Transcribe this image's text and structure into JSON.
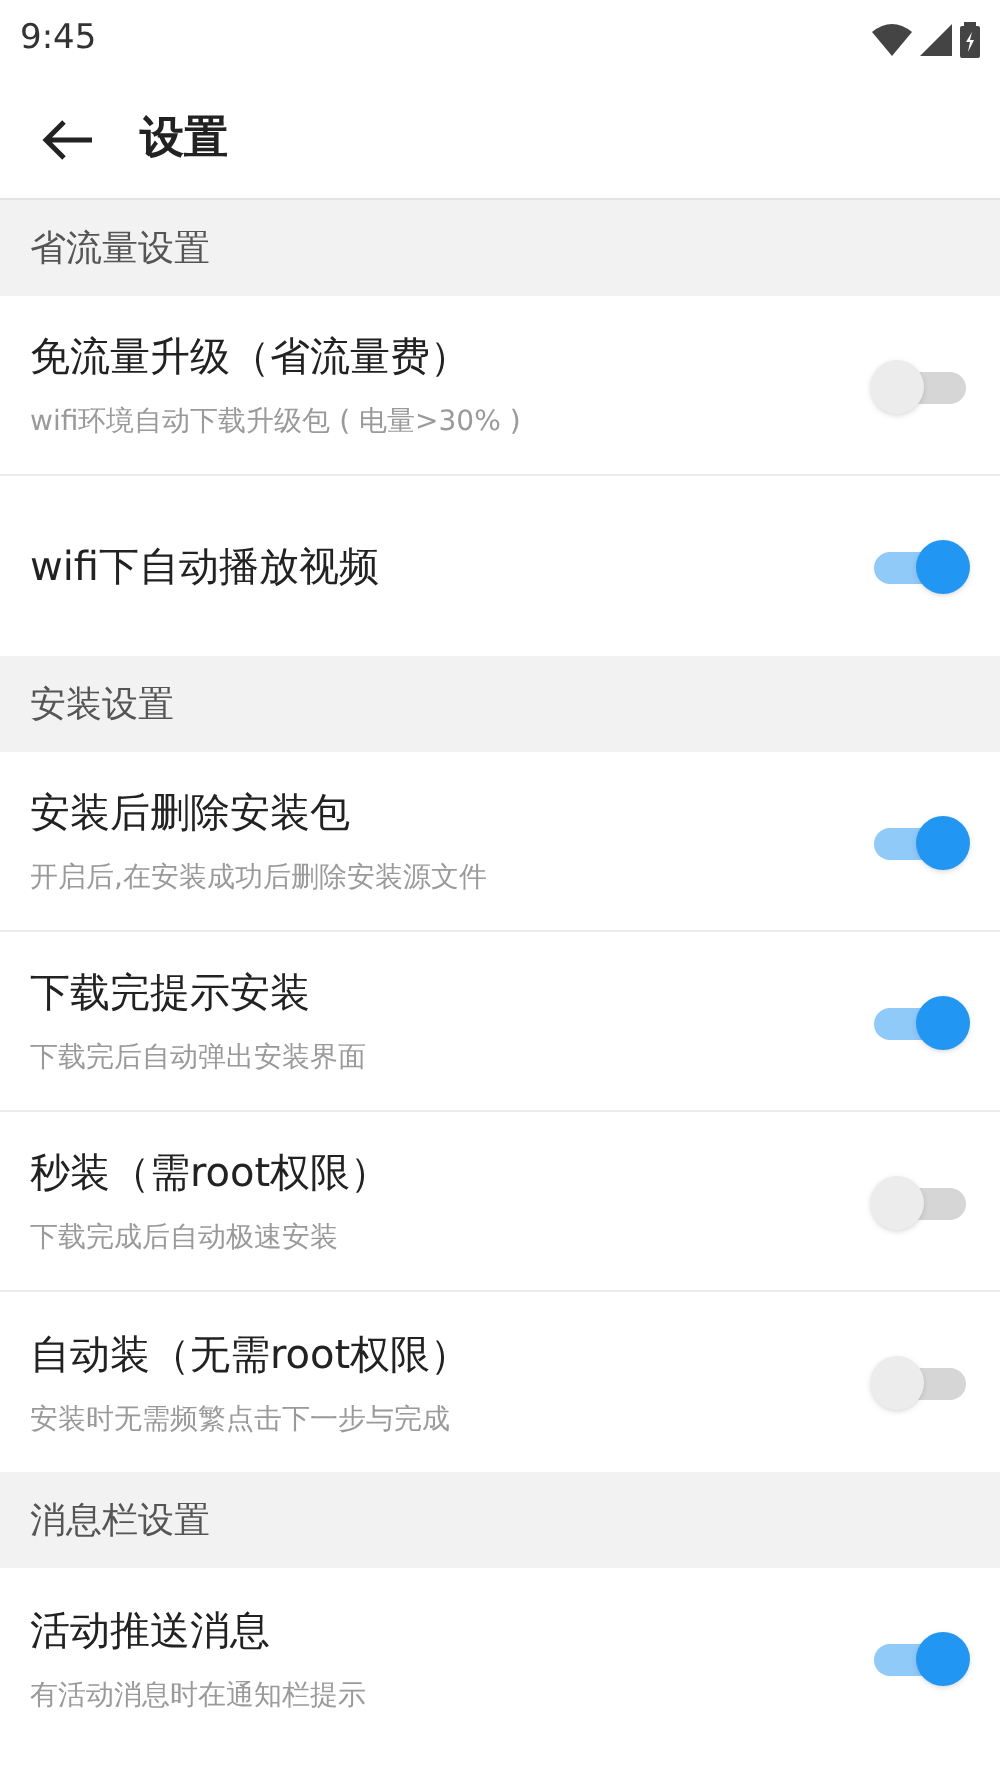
{
  "status_bar": {
    "time": "9:45"
  },
  "header": {
    "title": "设置"
  },
  "sections": [
    {
      "title": "省流量设置",
      "items": [
        {
          "title": "免流量升级（省流量费）",
          "subtitle": "wifi环境自动下载升级包 ( 电量>30% )",
          "on": false
        },
        {
          "title": "wifi下自动播放视频",
          "on": true
        }
      ]
    },
    {
      "title": "安装设置",
      "items": [
        {
          "title": "安装后删除安装包",
          "subtitle": "开启后,在安装成功后删除安装源文件",
          "on": true
        },
        {
          "title": "下载完提示安装",
          "subtitle": "下载完后自动弹出安装界面",
          "on": true
        },
        {
          "title": "秒装（需root权限）",
          "subtitle": "下载完成后自动极速安装",
          "on": false
        },
        {
          "title": "自动装（无需root权限）",
          "subtitle": "安装时无需频繁点击下一步与完成",
          "on": false
        }
      ]
    },
    {
      "title": "消息栏设置",
      "items": [
        {
          "title": "活动推送消息",
          "subtitle": "有活动消息时在通知栏提示",
          "on": true
        }
      ]
    }
  ]
}
